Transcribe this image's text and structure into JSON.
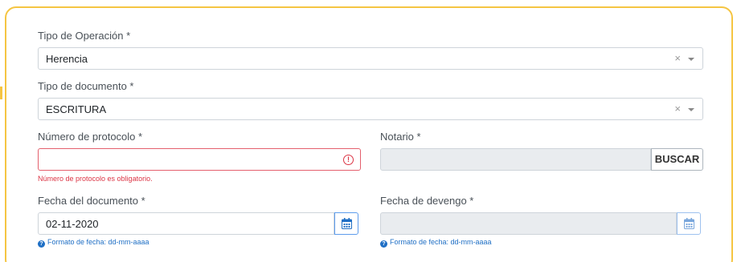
{
  "form": {
    "tipo_operacion": {
      "label": "Tipo de Operación *",
      "value": "Herencia",
      "clear": "×"
    },
    "tipo_documento": {
      "label": "Tipo de documento *",
      "value": "ESCRITURA",
      "clear": "×"
    },
    "numero_protocolo": {
      "label": "Número de protocolo *",
      "value": "",
      "error_icon": "!",
      "error": "Número de protocolo es obligatorio."
    },
    "notario": {
      "label": "Notario *",
      "value": "",
      "button": "BUSCAR"
    },
    "fecha_documento": {
      "label": "Fecha del documento *",
      "value": "02-11-2020",
      "help": "Formato de fecha: dd-mm-aaaa"
    },
    "fecha_devengo": {
      "label": "Fecha de devengo *",
      "value": "",
      "help": "Formato de fecha: dd-mm-aaaa"
    },
    "help_icon": "?"
  },
  "colors": {
    "card_border": "#f5c542",
    "error": "#dc3545",
    "help": "#1f6fc5",
    "disabled_bg": "#e9ecef"
  },
  "icons": [
    "chevron-down-icon",
    "close-icon",
    "error-icon",
    "calendar-icon",
    "question-circle-icon"
  ]
}
